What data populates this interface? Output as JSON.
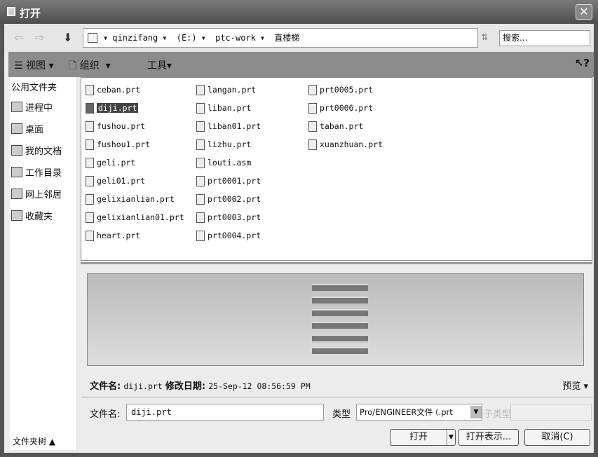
{
  "title": "打开",
  "address": {
    "segments": [
      "qinzifang",
      "(E:)",
      "ptc-work",
      "直楼梯"
    ],
    "search_placeholder": "搜索..."
  },
  "toolbar": {
    "view": "视图",
    "organize": "组织",
    "tools": "工具"
  },
  "sidebar": {
    "header": "公用文件夹",
    "items": [
      "进程中",
      "桌面",
      "我的文档",
      "工作目录",
      "网上邻居",
      "收藏夹"
    ],
    "footer": "文件夹树"
  },
  "files": [
    [
      "ceban.prt",
      "diji.prt",
      "fushou.prt",
      "fushou1.prt",
      "geli.prt",
      "geli01.prt",
      "gelixianlian.prt",
      "gelixianlian01.prt",
      "heart.prt"
    ],
    [
      "langan.prt",
      "liban.prt",
      "liban01.prt",
      "lizhu.prt",
      "louti.asm",
      "prt0001.prt",
      "prt0002.prt",
      "prt0003.prt",
      "prt0004.prt"
    ],
    [
      "prt0005.prt",
      "prt0006.prt",
      "taban.prt",
      "xuanzhuan.prt"
    ]
  ],
  "selected_file": "diji.prt",
  "info": {
    "name_label": "文件名:",
    "name": "diji.prt",
    "date_label": "修改日期:",
    "date": "25-Sep-12 08:56:59 PM",
    "preview": "预览"
  },
  "form": {
    "filename_label": "文件名:",
    "filename": "diji.prt",
    "type_label": "类型",
    "type": "Pro/ENGINEER文件 (.prt",
    "subtype_label": "子类型"
  },
  "buttons": {
    "open": "打开",
    "open_rep": "打开表示...",
    "cancel": "取消(C)"
  }
}
